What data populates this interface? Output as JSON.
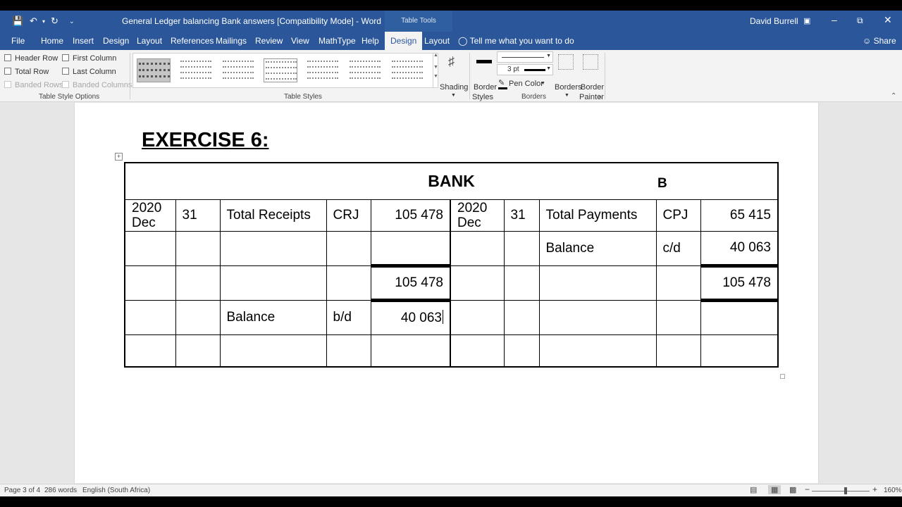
{
  "window": {
    "title": "General Ledger balancing Bank answers [Compatibility Mode]  -  Word",
    "contextual_tab_group": "Table Tools",
    "user": "David Burrell"
  },
  "quick_access": {
    "save_icon": "save-icon",
    "undo_icon": "undo-icon",
    "redo_icon": "redo-icon"
  },
  "tabs": [
    {
      "label": "File"
    },
    {
      "label": "Home"
    },
    {
      "label": "Insert"
    },
    {
      "label": "Design"
    },
    {
      "label": "Layout"
    },
    {
      "label": "References"
    },
    {
      "label": "Mailings"
    },
    {
      "label": "Review"
    },
    {
      "label": "View"
    },
    {
      "label": "MathType"
    },
    {
      "label": "Help"
    },
    {
      "label": "Design"
    },
    {
      "label": "Layout"
    }
  ],
  "active_tab": "Design",
  "tell_me": "Tell me what you want to do",
  "share": "Share",
  "ribbon": {
    "options": {
      "header_row": "Header Row",
      "first_column": "First Column",
      "total_row": "Total Row",
      "last_column": "Last Column",
      "banded_rows": "Banded Rows",
      "banded_columns": "Banded Columns",
      "group_label": "Table Style Options"
    },
    "styles_group_label": "Table Styles",
    "shading": "Shading",
    "border_styles_1": "Border",
    "border_styles_2": "Styles",
    "line_weight": "3 pt",
    "pen_color": "Pen Color",
    "borders": "Borders",
    "border_painter_1": "Border",
    "border_painter_2": "Painter",
    "borders_group_label": "Borders"
  },
  "document": {
    "heading": "EXERCISE 6:",
    "ledger_title": "BANK",
    "ledger_title_mark": "B",
    "rows": [
      [
        "2020\nDec",
        "31",
        "Total Receipts",
        "CRJ",
        "105 478",
        "2020\nDec",
        "31",
        "Total Payments",
        "CPJ",
        "65 415"
      ],
      [
        "",
        "",
        "",
        "",
        "",
        "",
        "",
        "Balance",
        "c/d",
        "40 063"
      ],
      [
        "",
        "",
        "",
        "",
        "105 478",
        "",
        "",
        "",
        "",
        "105 478"
      ],
      [
        "",
        "",
        "Balance",
        "b/d",
        "40 063",
        "",
        "",
        "",
        "",
        ""
      ],
      [
        "",
        "",
        "",
        "",
        "",
        "",
        "",
        "",
        "",
        ""
      ]
    ]
  },
  "status": {
    "page": "Page 3 of 4",
    "words": "286 words",
    "language": "English (South Africa)",
    "zoom": "160%"
  }
}
